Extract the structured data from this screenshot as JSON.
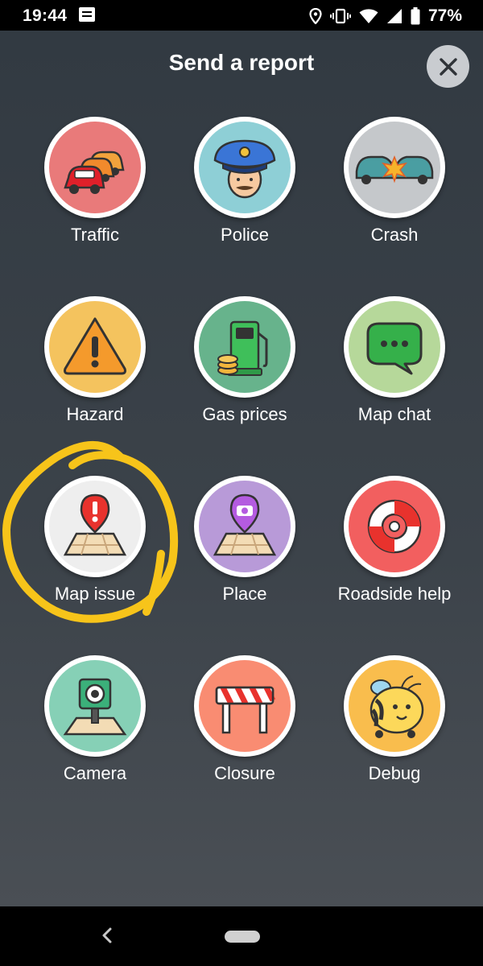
{
  "status_bar": {
    "time": "19:44",
    "battery": "77%"
  },
  "header": {
    "title": "Send a report"
  },
  "reports": [
    {
      "label": "Traffic",
      "icon": "traffic-icon",
      "color": "#e97a7a"
    },
    {
      "label": "Police",
      "icon": "police-icon",
      "color": "#8ecfd6"
    },
    {
      "label": "Crash",
      "icon": "crash-icon",
      "color": "#c5c8cb"
    },
    {
      "label": "Hazard",
      "icon": "hazard-icon",
      "color": "#f4c35e"
    },
    {
      "label": "Gas prices",
      "icon": "gas-pump-icon",
      "color": "#67b38c"
    },
    {
      "label": "Map chat",
      "icon": "chat-bubble-icon",
      "color": "#b6d89a"
    },
    {
      "label": "Map issue",
      "icon": "map-issue-icon",
      "color": "#eeeeee"
    },
    {
      "label": "Place",
      "icon": "place-camera-icon",
      "color": "#b89ad8"
    },
    {
      "label": "Roadside help",
      "icon": "lifebuoy-icon",
      "color": "#f25f5f"
    },
    {
      "label": "Camera",
      "icon": "speed-camera-icon",
      "color": "#86d0b6"
    },
    {
      "label": "Closure",
      "icon": "road-barrier-icon",
      "color": "#f98c72"
    },
    {
      "label": "Debug",
      "icon": "bee-icon",
      "color": "#f9bd4d"
    }
  ],
  "colors": {
    "highlight": "#f7c41a",
    "panel": "#353d44"
  }
}
